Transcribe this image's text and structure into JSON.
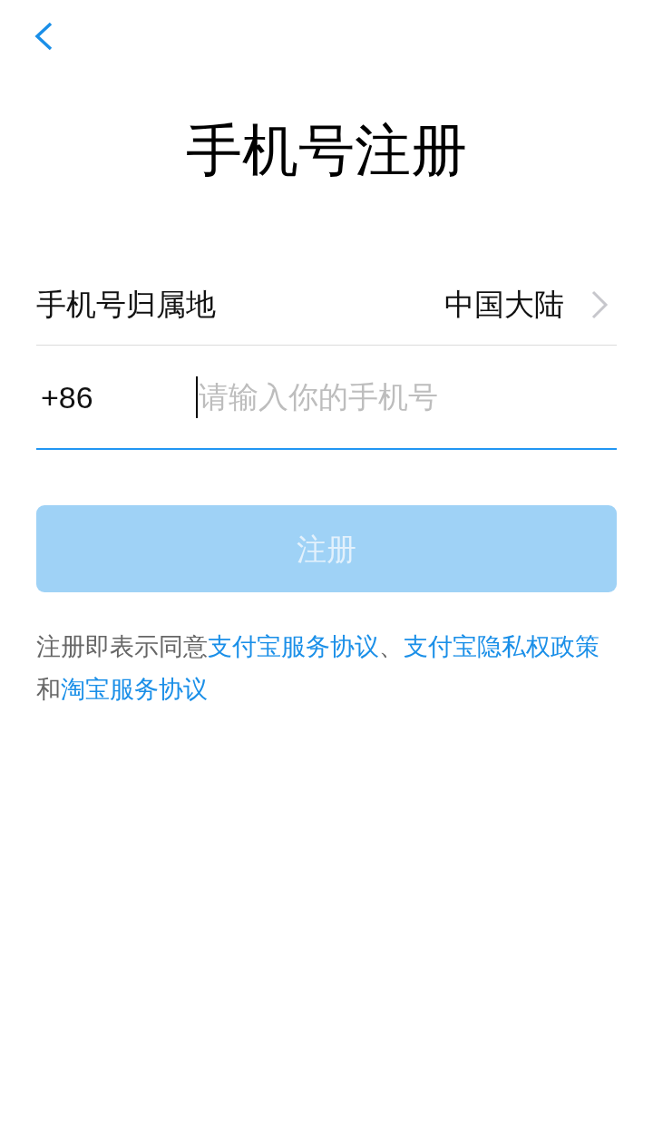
{
  "title": "手机号注册",
  "region": {
    "label": "手机号归属地",
    "value": "中国大陆"
  },
  "phone": {
    "country_code": "+86",
    "placeholder": "请输入你的手机号",
    "focused": true
  },
  "submit_button": {
    "label": "注册",
    "disabled": true
  },
  "agreement": [
    {
      "kind": "text",
      "text": "注册即表示同意"
    },
    {
      "kind": "link",
      "text": "支付宝服务协议"
    },
    {
      "kind": "text",
      "text": "、"
    },
    {
      "kind": "link",
      "text": "支付宝隐私权政策"
    },
    {
      "kind": "text",
      "text": "和"
    },
    {
      "kind": "link",
      "text": "淘宝服务协议"
    }
  ]
}
